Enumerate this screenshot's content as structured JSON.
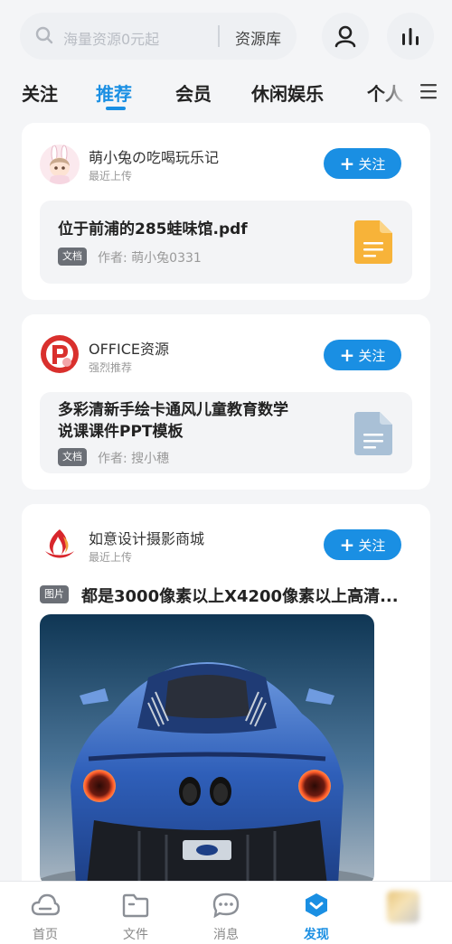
{
  "search": {
    "placeholder": "海量资源0元起",
    "library_label": "资源库"
  },
  "tabs": [
    {
      "label": "关注"
    },
    {
      "label": "推荐"
    },
    {
      "label": "会员"
    },
    {
      "label": "休闲娱乐"
    },
    {
      "label": "个人"
    }
  ],
  "cards": [
    {
      "author": "萌小兔の吃喝玩乐记",
      "subtitle": "最近上传",
      "follow_label": "关注",
      "doc_title": "位于前浦的285蛙味馆.pdf",
      "badge": "文档",
      "doc_author": "作者: 萌小兔0331",
      "file_icon": "pdf-file-icon"
    },
    {
      "author": "OFFICE资源",
      "subtitle": "强烈推荐",
      "follow_label": "关注",
      "doc_title_lines": [
        "多彩清新手绘卡通风儿童教育数学",
        "说课课件PPT模板"
      ],
      "badge": "文档",
      "doc_author": "作者: 搜小穗",
      "file_icon": "ppt-file-icon"
    },
    {
      "author": "如意设计摄影商城",
      "subtitle": "最近上传",
      "follow_label": "关注",
      "badge": "图片",
      "post_title": "都是3000像素以上X4200像素以上高清...",
      "image": "blue-sports-car-rear-photo"
    }
  ],
  "bottom_nav": [
    {
      "label": "首页",
      "icon": "cloud-icon"
    },
    {
      "label": "文件",
      "icon": "folder-icon"
    },
    {
      "label": "消息",
      "icon": "chat-icon"
    },
    {
      "label": "发现",
      "icon": "discover-icon",
      "active": true
    }
  ],
  "colors": {
    "accent": "#1a8fe3",
    "pdf_icon": "#f7b339",
    "ppt_icon": "#a9c0d6"
  }
}
